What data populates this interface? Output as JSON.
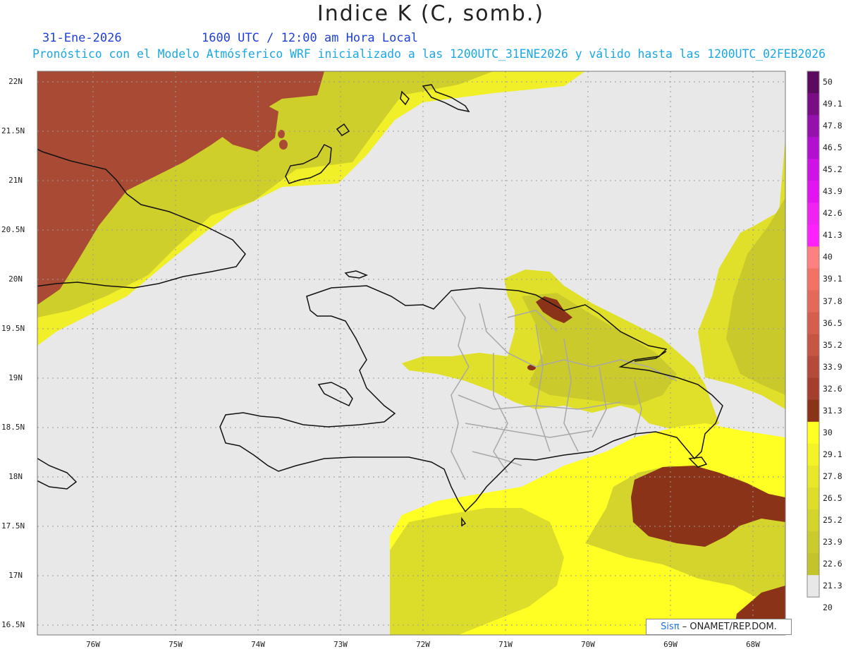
{
  "header": {
    "title": "Indice K (C, somb.)",
    "date": "31-Ene-2026",
    "time": "1600 UTC / 12:00 am Hora Local",
    "subtitle": "Pronóstico con el Modelo Atmósferico WRF inicializado a las 1200UTC_31ENE2026 y válido hasta las  1200UTC_02FEB2026"
  },
  "axes": {
    "lat_labels": [
      "22N",
      "21.5N",
      "21N",
      "20.5N",
      "20N",
      "19.5N",
      "19N",
      "18.5N",
      "18N",
      "17.5N",
      "17N",
      "16.5N"
    ],
    "lon_labels": [
      "76W",
      "75W",
      "74W",
      "73W",
      "72W",
      "71W",
      "70W",
      "69W",
      "68W"
    ]
  },
  "colorbar": {
    "levels": [
      "50",
      "49.1",
      "47.8",
      "46.5",
      "45.2",
      "43.9",
      "42.6",
      "41.3",
      "40",
      "39.1",
      "37.8",
      "36.5",
      "35.2",
      "33.9",
      "32.6",
      "31.3",
      "30",
      "29.1",
      "27.8",
      "26.5",
      "25.2",
      "23.9",
      "22.6",
      "21.3",
      "20"
    ],
    "colors": [
      "#5c0a5e",
      "#7a0d86",
      "#9411ad",
      "#b30fd0",
      "#cf12e5",
      "#e214f0",
      "#f023f2",
      "#ff22ff",
      "#ff8080",
      "#f27266",
      "#e3695a",
      "#d55f4e",
      "#c65544",
      "#b44a38",
      "#a33f2c",
      "#8a3318",
      "#ffff24",
      "#f4f326",
      "#e8e828",
      "#dede2a",
      "#d4d42c",
      "#cbcb2e",
      "#c3c32a",
      "#e8e8e8"
    ]
  },
  "credit": {
    "logo": "Sis",
    "pi": "π",
    "text": "– ONAMET/REP.DOM."
  }
}
